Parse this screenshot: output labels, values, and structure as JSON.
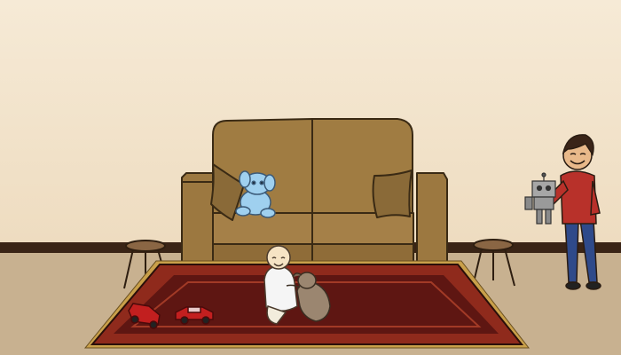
{
  "scene": {
    "kind": "cartoon living room illustration",
    "colors": {
      "wall_top": "#f6ead6",
      "wall_bottom": "#eedcc0",
      "baseboard": "#3a2416",
      "floor": "#c8b190",
      "sofa": "#a07c42",
      "sofa_dark": "#7a5a2c",
      "rug_outer": "#8f2a1c",
      "rug_inner": "#5e1612",
      "rug_fringe": "#c9a04a",
      "stool": "#7b5a3b",
      "toy_car": "#c21f1f",
      "teddy": "#9fd0ef",
      "dog": "#9b8670",
      "boy_shirt": "#b8312a",
      "boy_pants": "#2f4a8a"
    },
    "elements": [
      "wall",
      "floor",
      "sofa",
      "two-stools",
      "red-rug",
      "blue-teddy-bear",
      "baby",
      "puppy",
      "two-toy-cars",
      "boy-holding-toy-robot"
    ]
  }
}
